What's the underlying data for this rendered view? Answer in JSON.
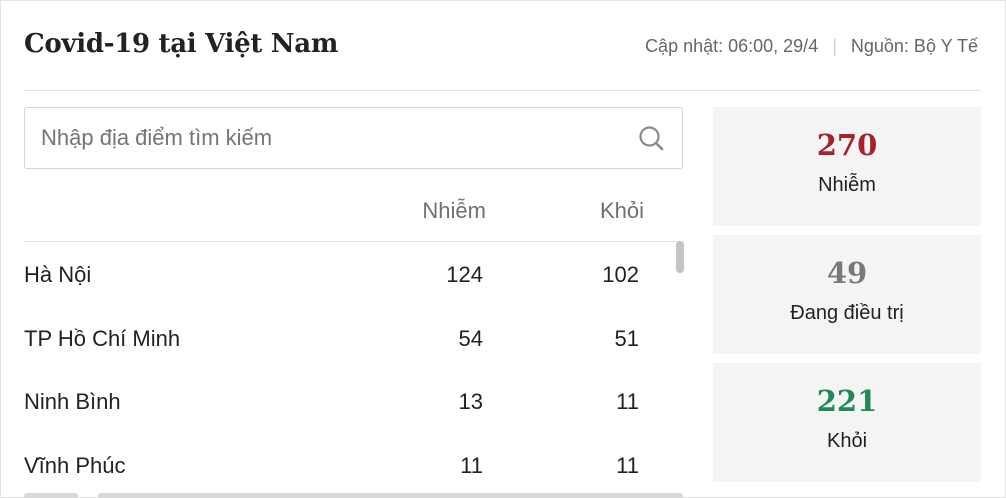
{
  "header": {
    "title": "Covid-19 tại Việt Nam",
    "updated": "Cập nhật: 06:00, 29/4",
    "separator": "|",
    "source": "Nguồn: Bộ Y Tế"
  },
  "search": {
    "placeholder": "Nhập địa điểm tìm kiếm",
    "value": ""
  },
  "table": {
    "columns": {
      "infected": "Nhiễm",
      "recovered": "Khỏi"
    },
    "rows": [
      {
        "name": "Hà Nội",
        "infected": "124",
        "recovered": "102"
      },
      {
        "name": "TP Hồ Chí Minh",
        "infected": "54",
        "recovered": "51"
      },
      {
        "name": "Ninh Bình",
        "infected": "13",
        "recovered": "11"
      },
      {
        "name": "Vĩnh Phúc",
        "infected": "11",
        "recovered": "11"
      }
    ]
  },
  "stats": [
    {
      "value": "270",
      "label": "Nhiễm",
      "color": "#a3222b"
    },
    {
      "value": "49",
      "label": "Đang điều trị",
      "color": "#7a7a7a"
    },
    {
      "value": "221",
      "label": "Khỏi",
      "color": "#1e8a5a"
    }
  ],
  "icons": {
    "search": "search-icon"
  }
}
